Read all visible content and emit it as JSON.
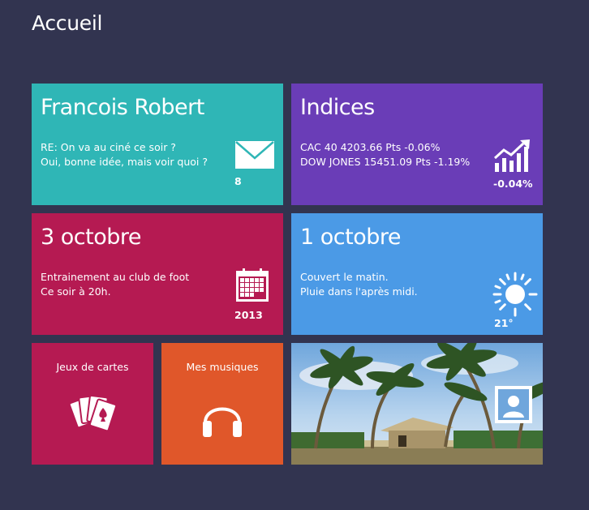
{
  "page": {
    "title": "Accueil"
  },
  "colors": {
    "background": "#323450",
    "mail": "#2fb6b6",
    "stocks": "#6a3db7",
    "calendar": "#b51a52",
    "weather": "#4b9ae6",
    "cards": "#b51a52",
    "music": "#e0572a"
  },
  "tiles": {
    "mail": {
      "title": "Francois Robert",
      "line1": "RE: On va au ciné ce soir ?",
      "line2": "Oui, bonne idée, mais voir quoi ?",
      "badge": "8",
      "icon": "envelope-icon"
    },
    "stocks": {
      "title": "Indices",
      "line1": "CAC 40 4203.66 Pts -0.06%",
      "line2": "DOW JONES 15451.09 Pts -1.19%",
      "badge": "-0.04%",
      "icon": "chart-rising-icon"
    },
    "calendar": {
      "title": "3 octobre",
      "line1": "Entrainement au club de foot",
      "line2": "Ce soir à 20h.",
      "badge": "2013",
      "icon": "calendar-icon"
    },
    "weather": {
      "title": "1 octobre",
      "line1": "Couvert le matin.",
      "line2": "Pluie dans l'après midi.",
      "badge": "21°",
      "icon": "sun-icon"
    },
    "cards": {
      "label": "Jeux de cartes",
      "icon": "playing-cards-icon"
    },
    "music": {
      "label": "Mes musiques",
      "icon": "headphones-icon"
    },
    "photos": {
      "icon": "portrait-photo-icon",
      "image": "tropical beach with palm trees and a hut"
    }
  }
}
